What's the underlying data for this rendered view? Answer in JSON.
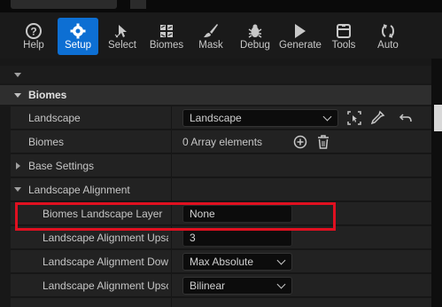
{
  "toolbar": {
    "tools": [
      {
        "label": "Help",
        "icon": "help-icon"
      },
      {
        "label": "Setup",
        "icon": "gear-icon",
        "active": true
      },
      {
        "label": "Select",
        "icon": "select-icon"
      },
      {
        "label": "Biomes",
        "icon": "biomes-icon"
      },
      {
        "label": "Mask",
        "icon": "brush-icon"
      },
      {
        "label": "Debug",
        "icon": "bug-icon"
      },
      {
        "label": "Generate",
        "icon": "play-icon"
      },
      {
        "label": "Tools",
        "icon": "toolbox-icon"
      },
      {
        "label": "Auto",
        "icon": "auto-icon"
      }
    ]
  },
  "panel": {
    "category": "Biomes",
    "landscape": {
      "label": "Landscape",
      "value": "Landscape"
    },
    "biomes": {
      "label": "Biomes",
      "value": "0 Array elements"
    },
    "base_settings": {
      "label": "Base Settings"
    },
    "alignment": {
      "label": "Landscape Alignment",
      "layer": {
        "label": "Biomes Landscape Layer",
        "value": "None"
      },
      "upsample": {
        "label": "Landscape Alignment Upsa...",
        "value": "3"
      },
      "downsample": {
        "label": "Landscape Alignment Dow...",
        "value": "Max Absolute"
      },
      "upscale": {
        "label": "Landscape Alignment Upsc...",
        "value": "Bilinear"
      }
    }
  },
  "colors": {
    "active_tool": "#0d6fd3",
    "highlight": "#e01020",
    "panel_bg": "#181818"
  }
}
